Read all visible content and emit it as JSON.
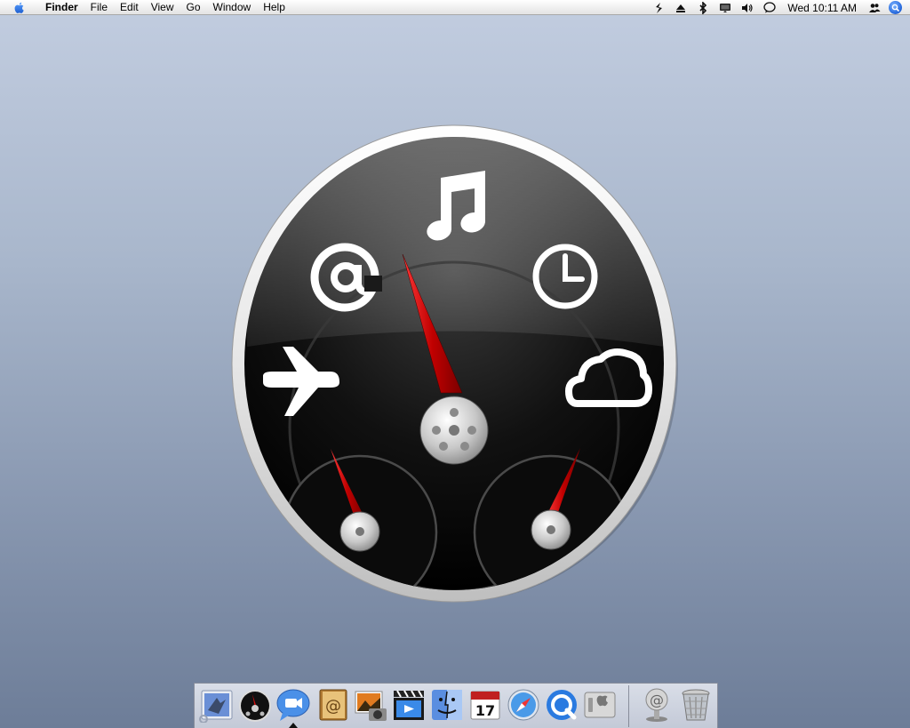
{
  "menubar": {
    "app_name": "Finder",
    "items": [
      "File",
      "Edit",
      "View",
      "Go",
      "Window",
      "Help"
    ],
    "clock": "Wed 10:11 AM",
    "status_icons": [
      "script-icon",
      "eject-icon",
      "bluetooth-icon",
      "display-icon",
      "volume-icon",
      "ichat-icon",
      "users-icon",
      "spotlight-icon"
    ]
  },
  "dashboard": {
    "widget_icons": [
      "music-note-icon",
      "at-sign-icon",
      "clock-icon",
      "airplane-icon",
      "cloud-icon"
    ]
  },
  "dock": {
    "items": [
      {
        "name": "Mail",
        "icon": "mail-icon"
      },
      {
        "name": "Dashboard",
        "icon": "dashboard-icon"
      },
      {
        "name": "iChat",
        "icon": "ichat-icon"
      },
      {
        "name": "Address Book",
        "icon": "address-book-icon"
      },
      {
        "name": "iPhoto",
        "icon": "iphoto-icon"
      },
      {
        "name": "iMovie",
        "icon": "imovie-icon"
      },
      {
        "name": "Finder",
        "icon": "finder-icon"
      },
      {
        "name": "iCal",
        "icon": "ical-icon",
        "date": "17"
      },
      {
        "name": "Safari",
        "icon": "safari-icon"
      },
      {
        "name": "QuickTime Player",
        "icon": "quicktime-icon"
      },
      {
        "name": "System Preferences",
        "icon": "system-preferences-icon"
      },
      {
        "name": "Mail Folder",
        "icon": "at-folder-icon"
      },
      {
        "name": "Trash",
        "icon": "trash-icon"
      }
    ]
  },
  "colors": {
    "desktop_top": "#c2cde0",
    "desktop_bottom": "#6d7d98",
    "needle_red": "#d01010",
    "gauge_face": "#000000",
    "spotlight_blue": "#2d6fe0"
  }
}
